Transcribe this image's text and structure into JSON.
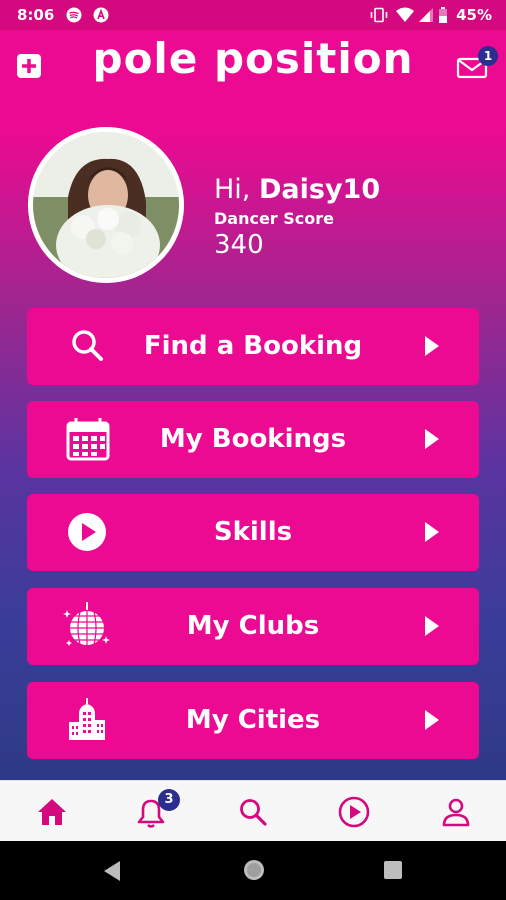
{
  "status_bar": {
    "time": "8:06",
    "battery": "45%"
  },
  "header": {
    "logo": "pole position",
    "mail_badge": "1"
  },
  "profile": {
    "greeting": "Hi, ",
    "username": "Daisy10",
    "score_label": "Dancer Score",
    "score_value": "340"
  },
  "menu": [
    {
      "label": "Find a Booking",
      "icon": "search-icon"
    },
    {
      "label": "My Bookings",
      "icon": "calendar-icon"
    },
    {
      "label": "Skills",
      "icon": "play-circle-icon"
    },
    {
      "label": "My Clubs",
      "icon": "disco-ball-icon"
    },
    {
      "label": "My Cities",
      "icon": "city-icon"
    }
  ],
  "bottom_nav": {
    "notifications_badge": "3"
  },
  "colors": {
    "primary": "#ec0a92",
    "badge": "#2b2e8f",
    "nav_icon": "#d4097f"
  }
}
